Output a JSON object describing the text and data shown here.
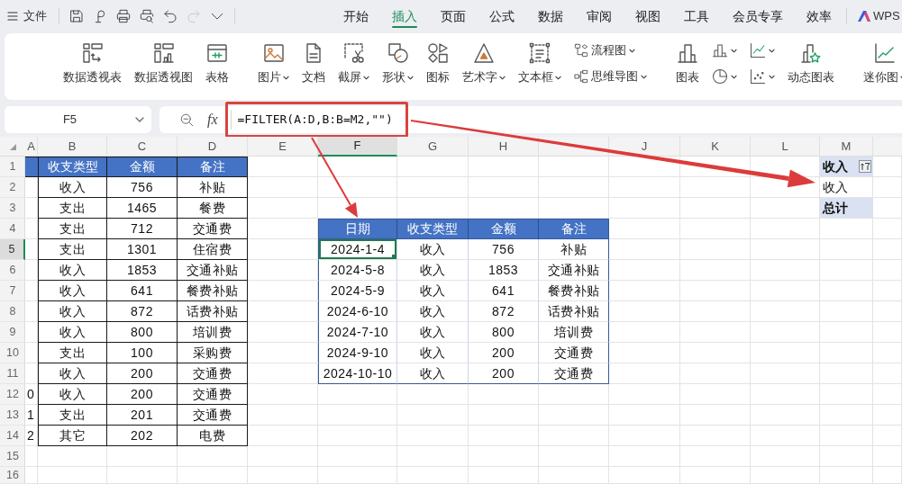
{
  "menu_bar": {
    "file": "文件",
    "quick_access": [
      {
        "kind": "save",
        "disabled": false
      },
      {
        "kind": "loop",
        "disabled": false
      },
      {
        "kind": "print",
        "disabled": false
      },
      {
        "kind": "preview",
        "disabled": false
      },
      {
        "kind": "undo",
        "disabled": false
      },
      {
        "kind": "redo",
        "disabled": true
      },
      {
        "kind": "more",
        "disabled": false
      }
    ],
    "tabs": [
      {
        "label": "开始",
        "selected": false
      },
      {
        "label": "插入",
        "selected": true
      },
      {
        "label": "页面",
        "selected": false
      },
      {
        "label": "公式",
        "selected": false
      },
      {
        "label": "数据",
        "selected": false
      },
      {
        "label": "审阅",
        "selected": false
      },
      {
        "label": "视图",
        "selected": false
      },
      {
        "label": "工具",
        "selected": false
      },
      {
        "label": "会员专享",
        "selected": false
      },
      {
        "label": "效率",
        "selected": false
      }
    ],
    "brand": "WPS"
  },
  "ribbon": {
    "groups": [
      {
        "items": [
          {
            "kind": "large",
            "label": "数据透视表",
            "dropdown": false
          },
          {
            "kind": "large",
            "label": "数据透视图",
            "dropdown": false
          },
          {
            "kind": "large",
            "label": "表格",
            "dropdown": false
          }
        ]
      },
      {
        "items": [
          {
            "kind": "large",
            "label": "图片",
            "dropdown": true
          },
          {
            "kind": "large",
            "label": "文档",
            "dropdown": false
          },
          {
            "kind": "large",
            "label": "截屏",
            "dropdown": true
          },
          {
            "kind": "large",
            "label": "形状",
            "dropdown": true
          },
          {
            "kind": "large",
            "label": "图标",
            "dropdown": false
          },
          {
            "kind": "large",
            "label": "艺术字",
            "dropdown": true
          },
          {
            "kind": "large",
            "label": "文本框",
            "dropdown": true
          },
          {
            "kind": "stack",
            "entries": [
              {
                "label": "流程图",
                "dropdown": true
              },
              {
                "label": "思维导图",
                "dropdown": true
              }
            ]
          }
        ]
      },
      {
        "items": [
          {
            "kind": "large",
            "label": "图表",
            "dropdown": false
          },
          {
            "kind": "stack",
            "entries": [
              {
                "dropdown": true
              },
              {
                "dropdown": true
              }
            ]
          },
          {
            "kind": "stack",
            "entries": [
              {
                "dropdown": true
              },
              {
                "dropdown": true
              }
            ]
          },
          {
            "kind": "large",
            "label": "动态图表",
            "dropdown": false
          }
        ]
      },
      {
        "items": [
          {
            "kind": "large",
            "label": "迷你图",
            "dropdown": true
          }
        ]
      }
    ]
  },
  "formula_bar": {
    "cell_name": "F5",
    "fx": "fx",
    "formula": "=FILTER(A:D,B:B=M2,\"\")"
  },
  "sheet": {
    "columns": [
      {
        "label": "A",
        "selected": false
      },
      {
        "label": "B",
        "selected": false
      },
      {
        "label": "C",
        "selected": false
      },
      {
        "label": "D",
        "selected": false
      },
      {
        "label": "E",
        "selected": false
      },
      {
        "label": "F",
        "selected": true
      },
      {
        "label": "G",
        "selected": false
      },
      {
        "label": "H",
        "selected": false
      },
      {
        "label": "J",
        "selected": false
      },
      {
        "label": "K",
        "selected": false
      },
      {
        "label": "L",
        "selected": false
      },
      {
        "label": "M",
        "selected": false
      }
    ],
    "rows": [
      {
        "label": "1",
        "selected": false
      },
      {
        "label": "2",
        "selected": false
      },
      {
        "label": "3",
        "selected": false
      },
      {
        "label": "4",
        "selected": false
      },
      {
        "label": "5",
        "selected": true
      },
      {
        "label": "6",
        "selected": false
      },
      {
        "label": "7",
        "selected": false
      },
      {
        "label": "8",
        "selected": false
      },
      {
        "label": "9",
        "selected": false
      },
      {
        "label": "10",
        "selected": false
      },
      {
        "label": "11",
        "selected": false
      },
      {
        "label": "12",
        "selected": false
      },
      {
        "label": "13",
        "selected": false
      },
      {
        "label": "14",
        "selected": false
      },
      {
        "label": "15",
        "selected": false
      },
      {
        "label": "16",
        "selected": false
      }
    ]
  },
  "source_table": {
    "header": [
      "收支类型",
      "金额",
      "备注"
    ],
    "rows": [
      {
        "cells": [
          "收入",
          "756",
          "补贴"
        ]
      },
      {
        "cells": [
          "支出",
          "1465",
          "餐费"
        ]
      },
      {
        "cells": [
          "支出",
          "712",
          "交通费"
        ]
      },
      {
        "cells": [
          "支出",
          "1301",
          "住宿费"
        ]
      },
      {
        "cells": [
          "收入",
          "1853",
          "交通补贴"
        ]
      },
      {
        "cells": [
          "收入",
          "641",
          "餐费补贴"
        ]
      },
      {
        "cells": [
          "收入",
          "872",
          "话费补贴"
        ]
      },
      {
        "cells": [
          "收入",
          "800",
          "培训费"
        ]
      },
      {
        "cells": [
          "支出",
          "100",
          "采购费"
        ]
      },
      {
        "cells": [
          "收入",
          "200",
          "交通费"
        ]
      },
      {
        "column_a": "0",
        "cells": [
          "收入",
          "200",
          "交通费"
        ]
      },
      {
        "column_a": "1",
        "cells": [
          "支出",
          "201",
          "交通费"
        ]
      },
      {
        "column_a": "2",
        "cells": [
          "其它",
          "202",
          "电费"
        ]
      }
    ]
  },
  "filter_result": {
    "header": [
      "日期",
      "收支类型",
      "金额",
      "备注"
    ],
    "rows": [
      {
        "cells": [
          {
            "text": "2024-1-4",
            "selected": true
          },
          {
            "text": "收入",
            "selected": false
          },
          {
            "text": "756",
            "selected": false
          },
          {
            "text": "补贴",
            "selected": false
          }
        ]
      },
      {
        "cells": [
          {
            "text": "2024-5-8",
            "selected": false
          },
          {
            "text": "收入",
            "selected": false
          },
          {
            "text": "1853",
            "selected": false
          },
          {
            "text": "交通补贴",
            "selected": false
          }
        ]
      },
      {
        "cells": [
          {
            "text": "2024-5-9",
            "selected": false
          },
          {
            "text": "收入",
            "selected": false
          },
          {
            "text": "641",
            "selected": false
          },
          {
            "text": "餐费补贴",
            "selected": false
          }
        ]
      },
      {
        "cells": [
          {
            "text": "2024-6-10",
            "selected": false
          },
          {
            "text": "收入",
            "selected": false
          },
          {
            "text": "872",
            "selected": false
          },
          {
            "text": "话费补贴",
            "selected": false
          }
        ]
      },
      {
        "cells": [
          {
            "text": "2024-7-10",
            "selected": false
          },
          {
            "text": "收入",
            "selected": false
          },
          {
            "text": "800",
            "selected": false
          },
          {
            "text": "培训费",
            "selected": false
          }
        ]
      },
      {
        "cells": [
          {
            "text": "2024-9-10",
            "selected": false
          },
          {
            "text": "收入",
            "selected": false
          },
          {
            "text": "200",
            "selected": false
          },
          {
            "text": "交通费",
            "selected": false
          }
        ]
      },
      {
        "cells": [
          {
            "text": "2024-10-10",
            "selected": false
          },
          {
            "text": "收入",
            "selected": false
          },
          {
            "text": "200",
            "selected": false
          },
          {
            "text": "交通费",
            "selected": false
          }
        ]
      }
    ]
  },
  "pivot": {
    "header": "收入",
    "item": "收入",
    "total": "总计"
  }
}
